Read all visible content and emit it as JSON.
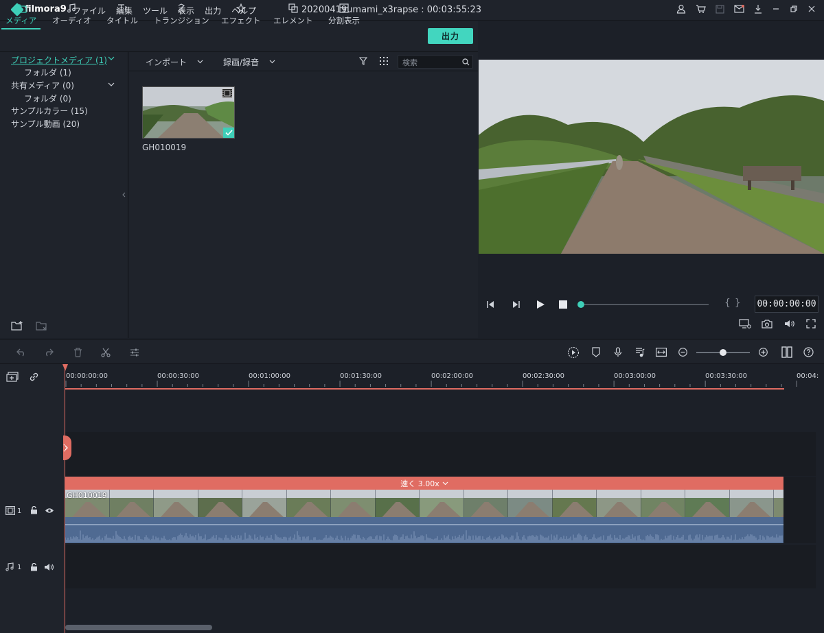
{
  "app": {
    "brand": "filmora9",
    "document_title": "20200419umami_x3rapse : 00:03:55:23",
    "menu": [
      "ファイル",
      "編集",
      "ツール",
      "表示",
      "出力",
      "ヘルプ"
    ]
  },
  "toolbar": {
    "tabs": [
      {
        "label": "メディア",
        "icon": "folder-icon"
      },
      {
        "label": "オーディオ",
        "icon": "music-note-icon"
      },
      {
        "label": "タイトル",
        "icon": "title-icon"
      },
      {
        "label": "トランジション",
        "icon": "transition-icon"
      },
      {
        "label": "エフェクト",
        "icon": "effect-icon"
      },
      {
        "label": "エレメント",
        "icon": "element-icon"
      },
      {
        "label": "分割表示",
        "icon": "split-screen-icon"
      }
    ],
    "export_label": "出力"
  },
  "library": {
    "items": [
      {
        "label": "プロジェクトメディア (1)"
      },
      {
        "label": "フォルダ (1)"
      },
      {
        "label": "共有メディア (0)"
      },
      {
        "label": "フォルダ (0)"
      },
      {
        "label": "サンプルカラー (15)"
      },
      {
        "label": "サンプル動画 (20)"
      }
    ]
  },
  "media": {
    "import_label": "インポート",
    "record_label": "録画/録音",
    "search_placeholder": "検索",
    "clips": [
      {
        "name": "GH010019"
      }
    ]
  },
  "preview": {
    "timecode": "00:00:00:00",
    "progress": 0.0
  },
  "timeline": {
    "ruler_labels": [
      "00:00:00:00",
      "00:00:30:00",
      "00:01:00:00",
      "00:01:30:00",
      "00:02:00:00",
      "00:02:30:00",
      "00:03:00:00",
      "00:03:30:00",
      "00:04:"
    ],
    "speed_label": "速く 3.00x",
    "clip_name": "GH010019",
    "video_track": {
      "label": "1"
    },
    "audio_track": {
      "label": "1"
    }
  },
  "colors": {
    "accent": "#3ecfb8",
    "playhead": "#e06c62",
    "audio_clip": "#4f6a92"
  }
}
